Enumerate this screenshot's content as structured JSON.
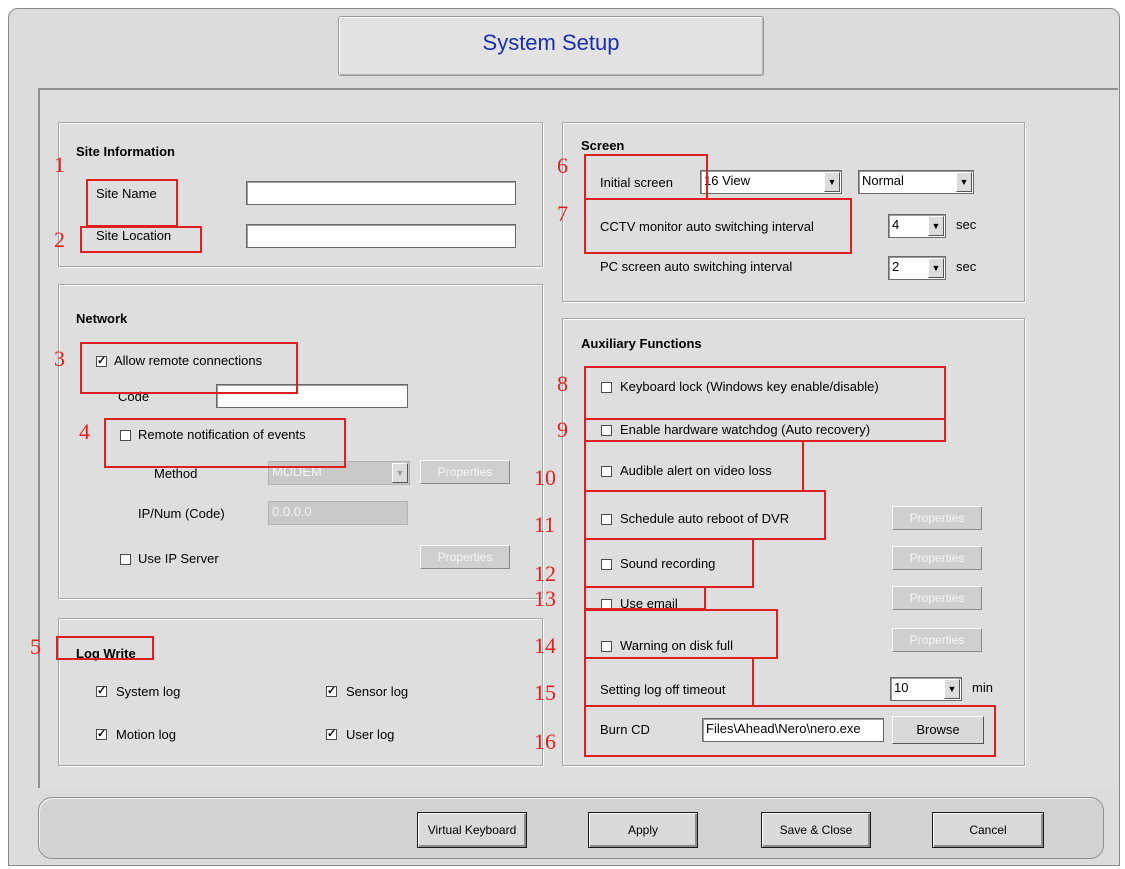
{
  "window": {
    "title": "System Setup"
  },
  "site_information": {
    "heading": "Site Information",
    "site_name_label": "Site Name",
    "site_name_value": "",
    "site_location_label": "Site Location",
    "site_location_value": ""
  },
  "network": {
    "heading": "Network",
    "allow_remote_label": "Allow remote connections",
    "allow_remote_checked": true,
    "code_label": "Code",
    "code_value": "",
    "remote_notification_label": "Remote notification of events",
    "remote_notification_checked": false,
    "method_label": "Method",
    "method_value": "MODEM",
    "properties_label": "Properties",
    "ipnum_label": "IP/Num (Code)",
    "ipnum_value": "0.0.0.0",
    "use_ip_server_label": "Use IP Server",
    "use_ip_server_checked": false
  },
  "log_write": {
    "heading": "Log Write",
    "system_log": "System log",
    "sensor_log": "Sensor log",
    "motion_log": "Motion log",
    "user_log": "User log",
    "system_log_checked": true,
    "sensor_log_checked": true,
    "motion_log_checked": true,
    "user_log_checked": true
  },
  "screen": {
    "heading": "Screen",
    "initial_screen_label": "Initial screen",
    "initial_screen_value": "16 View",
    "initial_screen_mode": "Normal",
    "cctv_label": "CCTV monitor auto switching interval",
    "cctv_value": "4",
    "pc_label": "PC screen auto switching interval",
    "pc_value": "2",
    "sec_unit": "sec"
  },
  "auxiliary": {
    "heading": "Auxiliary Functions",
    "keyboard_lock": "Keyboard lock (Windows key enable/disable)",
    "hardware_watchdog": "Enable hardware watchdog (Auto recovery)",
    "audible_alert": "Audible alert on video loss",
    "auto_reboot": "Schedule auto reboot of DVR",
    "sound_recording": "Sound recording",
    "use_email": "Use email",
    "disk_full": "Warning on disk full",
    "logoff_label": "Setting log off timeout",
    "logoff_value": "10",
    "logoff_unit": "min",
    "burn_cd_label": "Burn CD",
    "burn_cd_path": "Files\\Ahead\\Nero\\nero.exe",
    "browse_label": "Browse",
    "properties_label": "Properties"
  },
  "annotations": [
    "1",
    "2",
    "3",
    "4",
    "5",
    "6",
    "7",
    "8",
    "9",
    "10",
    "11",
    "12",
    "13",
    "14",
    "15",
    "16"
  ],
  "buttons": {
    "virtual_keyboard": "Virtual Keyboard",
    "apply": "Apply",
    "save_close": "Save & Close",
    "cancel": "Cancel"
  },
  "colors": {
    "title": "#1a2fa8",
    "annotation": "#e02020",
    "panel": "#dedede"
  }
}
